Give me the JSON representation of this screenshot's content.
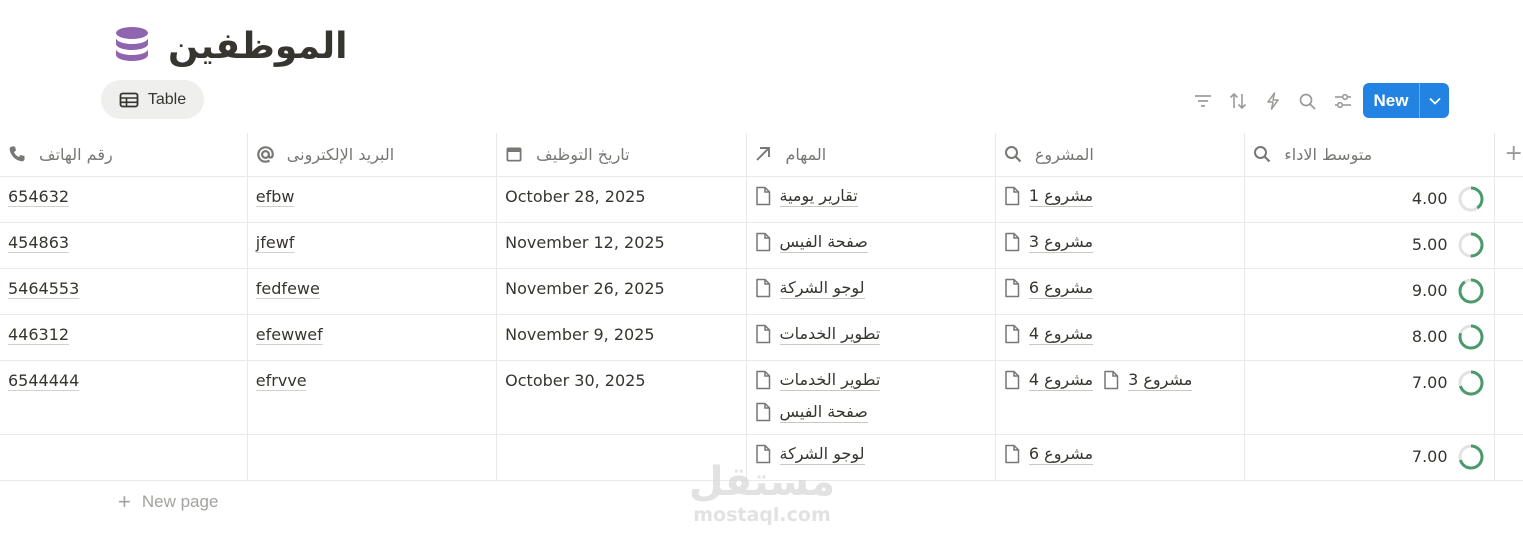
{
  "page": {
    "title": "الموظفين"
  },
  "view": {
    "tab_label": "Table"
  },
  "toolbar": {
    "new_label": "New"
  },
  "columns": [
    {
      "label": "رقم الهاتف",
      "icon": "phone-icon"
    },
    {
      "label": "البريد الإلكترونى",
      "icon": "at-icon"
    },
    {
      "label": "تاريخ التوظيف",
      "icon": "calendar-icon"
    },
    {
      "label": "المهام",
      "icon": "relation-arrow-icon"
    },
    {
      "label": "المشروع",
      "icon": "search-icon"
    },
    {
      "label": "متوسط الاداء",
      "icon": "search-icon"
    }
  ],
  "rows": [
    {
      "phone": "654632",
      "email": "efbw",
      "date": "October 28, 2025",
      "tasks": [
        "تقارير يومية"
      ],
      "projects": [
        "مشروع 1"
      ],
      "avg": "4.00",
      "progress": 0.4
    },
    {
      "phone": "454863",
      "email": "jfewf",
      "date": "November 12, 2025",
      "tasks": [
        "صفحة الفيس"
      ],
      "projects": [
        "مشروع 3"
      ],
      "avg": "5.00",
      "progress": 0.5
    },
    {
      "phone": "5464553",
      "email": "fedfewe",
      "date": "November 26, 2025",
      "tasks": [
        "لوجو الشركة"
      ],
      "projects": [
        "مشروع 6"
      ],
      "avg": "9.00",
      "progress": 0.9
    },
    {
      "phone": "446312",
      "email": "efewwef",
      "date": "November 9, 2025",
      "tasks": [
        "تطوير الخدمات"
      ],
      "projects": [
        "مشروع 4"
      ],
      "avg": "8.00",
      "progress": 0.8
    },
    {
      "phone": "6544444",
      "email": "efrvve",
      "date": "October 30, 2025",
      "tasks": [
        "تطوير الخدمات",
        "صفحة الفيس"
      ],
      "projects": [
        "مشروع 4",
        "مشروع 3"
      ],
      "avg": "7.00",
      "progress": 0.7
    },
    {
      "phone": "",
      "email": "",
      "date": "",
      "tasks": [
        "لوجو الشركة"
      ],
      "projects": [
        "مشروع 6"
      ],
      "avg": "7.00",
      "progress": 0.7
    }
  ],
  "footer": {
    "new_page_label": "New page"
  },
  "watermark": {
    "arabic": "مستقل",
    "latin": "mostaql.com"
  },
  "colors": {
    "accent": "#2383e2",
    "progress": "#4a9a6a",
    "track": "#e3e2e0",
    "db_icon": "#9065b0"
  }
}
